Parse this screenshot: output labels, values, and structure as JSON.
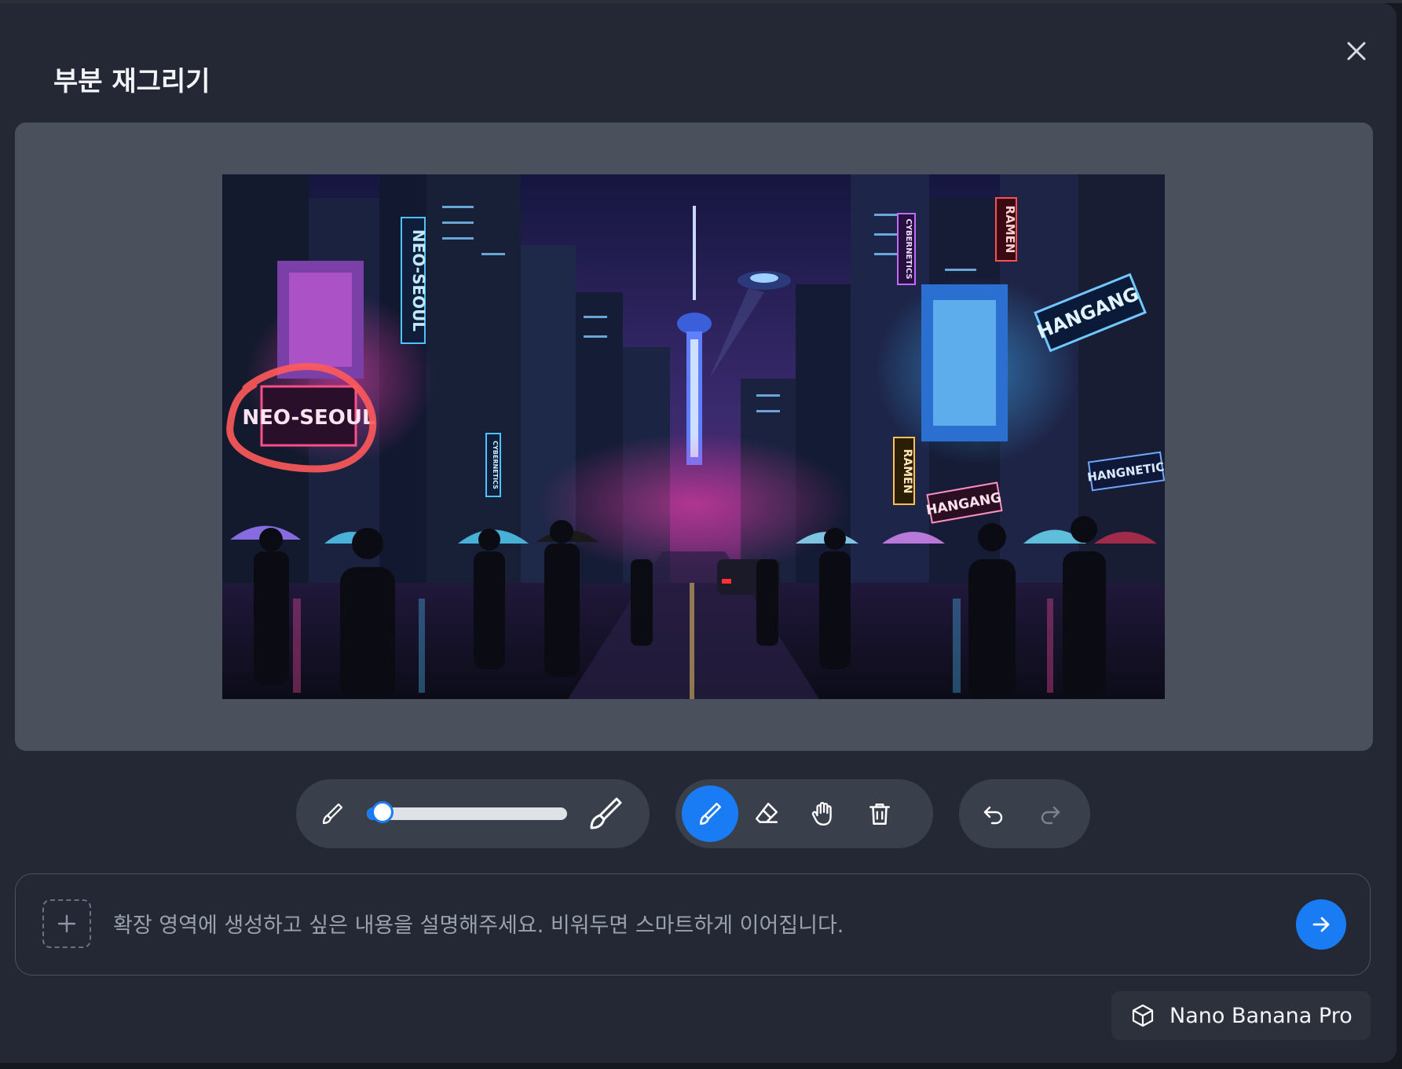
{
  "modal": {
    "title": "부분 재그리기"
  },
  "scene": {
    "signs": [
      "NEO-SEOUL",
      "NEO-SEOUL",
      "CYBERNETICS",
      "RAMEN",
      "HANGANG",
      "RAMEN",
      "HANGANG",
      "HANGNETIC",
      "CYBERNETICS"
    ]
  },
  "brush_size": {
    "value": 0.08
  },
  "tools": [
    {
      "name": "brush",
      "active": true
    },
    {
      "name": "eraser",
      "active": false
    },
    {
      "name": "hand",
      "active": false
    },
    {
      "name": "trash",
      "active": false
    }
  ],
  "prompt": {
    "placeholder": "확장 영역에 생성하고 싶은 내용을 설명해주세요. 비워두면 스마트하게 이어집니다.",
    "value": ""
  },
  "model": {
    "label": "Nano Banana Pro"
  },
  "colors": {
    "accent": "#1a7cf5",
    "mask": "#ff5a5a",
    "modal_bg": "#232834",
    "canvas_bg": "#4a505c"
  }
}
